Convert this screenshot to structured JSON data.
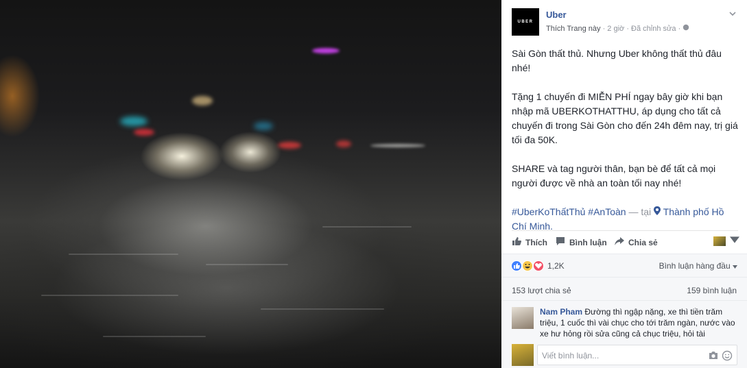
{
  "post": {
    "page_name": "Uber",
    "logo_text": "UBER",
    "like_page_label": "Thích Trang này",
    "time": "2 giờ",
    "edited": "Đã chỉnh sửa",
    "separator": "·",
    "paragraph1": "Sài Gòn thất thủ. Nhưng Uber không thất thủ đâu nhé!",
    "paragraph2": "Tặng 1 chuyến đi MIỄN PHÍ ngay bây giờ khi bạn nhập mã UBERKOTHATTHU, áp dụng cho tất cả chuyến đi trong Sài Gòn cho đến 24h đêm nay, trị giá tối đa 50K.",
    "paragraph3": "SHARE và tag người thân, bạn bè để tất cả mọi người được về nhà an toàn tối nay nhé!",
    "hashtag1": "#UberKoThấtThủ",
    "hashtag2": "#AnToàn",
    "at_label": "— tại",
    "location": "Thành phố Hồ Chí Minh."
  },
  "actions": {
    "like": "Thích",
    "comment": "Bình luận",
    "share": "Chia sẻ"
  },
  "reactions": {
    "count": "1,2K",
    "sort_label": "Bình luận hàng đầu"
  },
  "stats": {
    "shares": "153 lượt chia sẻ",
    "comments": "159 bình luận"
  },
  "comment": {
    "author": "Nam Pham",
    "text": "Đường thì ngập nặng, xe thì tiền trăm triệu, 1 cuốc thì vài chục cho tới trăm ngàn, nước vào xe hư hỏng rồi sửa cũng cả chục triệu, hỏi tài"
  },
  "write_comment": {
    "placeholder": "Viết bình luận..."
  },
  "colors": {
    "link": "#365899",
    "secondary": "#90949c",
    "panel_bg": "#f6f7f9",
    "like_blue": "#4080ff",
    "haha_yellow": "#f7c64a",
    "love_red": "#f25268"
  }
}
